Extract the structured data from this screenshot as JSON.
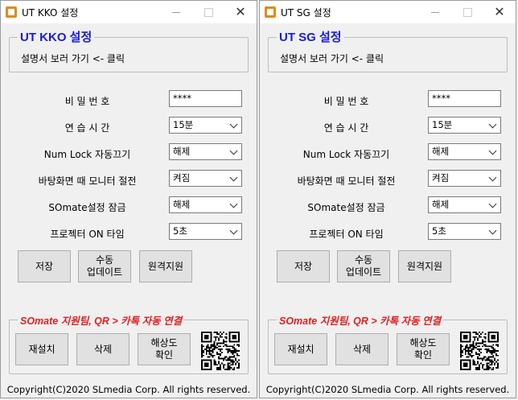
{
  "windows": [
    {
      "title": "UT KKO 설정",
      "group_title": "UT KKO 설정",
      "manual_link": "설명서 보러 가기 <- 클릭",
      "password": {
        "label": "비   밀   번   호",
        "value": "****"
      },
      "practice_time": {
        "label": "연   습   시   간",
        "value": "15분"
      },
      "numlock": {
        "label": "Num Lock 자동끄기",
        "value": "해제"
      },
      "monitor_off": {
        "label": "바탕화면 때 모니터 절전",
        "value": "켜짐"
      },
      "somate_lock": {
        "label": "SOmate설정 잠금",
        "value": "해제"
      },
      "projector": {
        "label": "프로젝터 ON 타임",
        "value": "5초"
      },
      "buttons": {
        "save": "저장",
        "manual_update_1": "수동",
        "manual_update_2": "업데이트",
        "remote": "원격지원"
      },
      "support_title": "SOmate 지원팀, QR > 카톡 자동 연결",
      "support_buttons": {
        "reinstall": "재설치",
        "delete": "삭제",
        "resolution_1": "해상도",
        "resolution_2": "확인"
      },
      "copyright": "Copyright(C)2020 SLmedia Corp. All rights reserved."
    },
    {
      "title": "UT SG 설정",
      "group_title": "UT SG 설정",
      "manual_link": "설명서 보러 가기 <- 클릭",
      "password": {
        "label": "비   밀   번   호",
        "value": "****"
      },
      "practice_time": {
        "label": "연   습   시   간",
        "value": "15분"
      },
      "numlock": {
        "label": "Num Lock 자동끄기",
        "value": "해제"
      },
      "monitor_off": {
        "label": "바탕화면 때 모니터 절전",
        "value": "켜짐"
      },
      "somate_lock": {
        "label": "SOmate설정 잠금",
        "value": "해제"
      },
      "projector": {
        "label": "프로젝터 ON 타임",
        "value": "5초"
      },
      "buttons": {
        "save": "저장",
        "manual_update_1": "수동",
        "manual_update_2": "업데이트",
        "remote": "원격지원"
      },
      "support_title": "SOmate 지원팀, QR > 카톡 자동 연결",
      "support_buttons": {
        "reinstall": "재설치",
        "delete": "삭제",
        "resolution_1": "해상도",
        "resolution_2": "확인"
      },
      "copyright": "Copyright(C)2020 SLmedia Corp. All rights reserved."
    }
  ],
  "icons": {
    "close": "close-icon",
    "minimize": "minimize-icon",
    "maximize": "maximize-icon",
    "app": "app-icon",
    "qr": "qr-code"
  },
  "colors": {
    "group_title": "#1a1adc",
    "support_title": "#e02020",
    "window_bg": "#f0f0f0"
  }
}
